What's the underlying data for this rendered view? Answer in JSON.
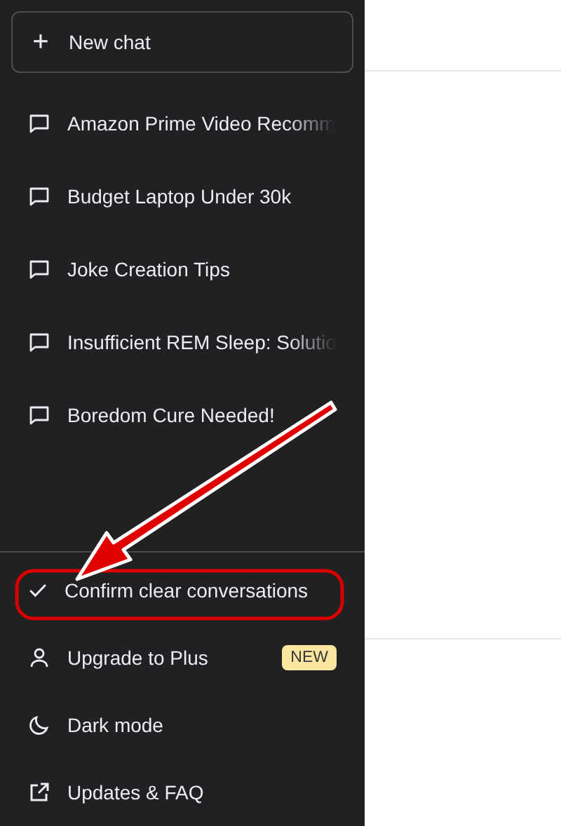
{
  "sidebar": {
    "new_chat": {
      "icon": "+",
      "label": "New chat"
    },
    "chats": [
      {
        "title": "Amazon Prime Video Recomm",
        "faded": true
      },
      {
        "title": "Budget Laptop Under 30k",
        "faded": false
      },
      {
        "title": "Joke Creation Tips",
        "faded": false
      },
      {
        "title": "Insufficient REM Sleep: Solutio",
        "faded": true
      },
      {
        "title": "Boredom Cure Needed!",
        "faded": false
      }
    ],
    "menu": [
      {
        "kind": "confirm",
        "label": "Confirm clear conversations",
        "highlighted": true
      },
      {
        "kind": "upgrade",
        "label": "Upgrade to Plus",
        "badge": "NEW",
        "highlighted": false
      },
      {
        "kind": "theme",
        "label": "Dark mode",
        "highlighted": false
      },
      {
        "kind": "link",
        "label": "Updates & FAQ",
        "highlighted": false
      }
    ]
  }
}
